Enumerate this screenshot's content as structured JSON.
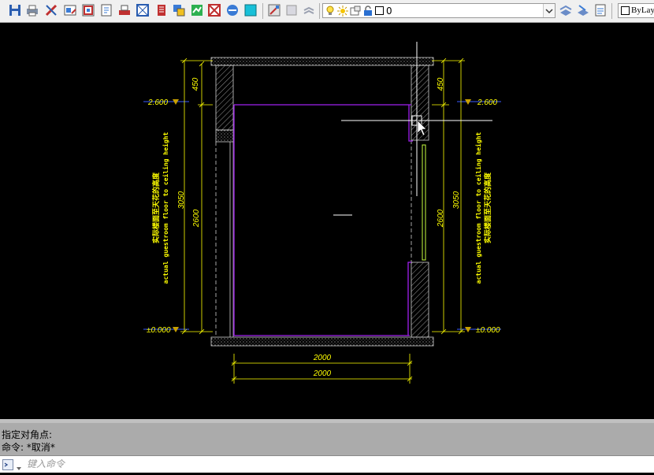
{
  "toolbar": {
    "buttons": [
      {
        "name": "save-icon"
      },
      {
        "name": "print-icon"
      },
      {
        "name": "match-properties-icon"
      },
      {
        "name": "block-editor-icon"
      },
      {
        "name": "design-center-icon"
      },
      {
        "name": "publish-icon"
      },
      {
        "name": "plot-icon"
      },
      {
        "name": "sheet-set-icon"
      },
      {
        "name": "tool-palette-icon"
      },
      {
        "name": "markup-icon"
      },
      {
        "name": "xref-icon"
      },
      {
        "name": "calculator-icon"
      },
      {
        "name": "image-icon"
      },
      {
        "name": "layer-manager-icon"
      },
      {
        "name": "layer-states-icon"
      },
      {
        "name": "layer-previous-icon"
      }
    ],
    "layer_combo_value": "0",
    "layer_flags": [
      "lightbulb-icon",
      "sun-icon",
      "lock-icon",
      "color-swatch-icon"
    ],
    "right_buttons": [
      {
        "name": "make-current-icon"
      },
      {
        "name": "layer-match-icon"
      },
      {
        "name": "layer-walk-icon"
      }
    ],
    "color_combo_value": "ByLay"
  },
  "drawing": {
    "colors": {
      "background": "#000000",
      "dimension": "#ffff00",
      "wall": "#ffffff",
      "finish": "#a020f0",
      "level_line": "#3a5cff",
      "crosshair": "#ffffff"
    },
    "level_left_top": "2.600",
    "level_left_bottom": "±0.000",
    "level_right_top": "2.600",
    "level_right_bottom": "±0.000",
    "dim_left_450": "450",
    "dim_left_3050": "3050",
    "dim_left_2600": "2600",
    "dim_right_450": "450",
    "dim_right_3050": "3050",
    "dim_right_2600": "2600",
    "dim_bottom_1": "2000",
    "dim_bottom_2": "2000",
    "note_left_cn": "实际楼面至天花的高度",
    "note_left_en": "actual guestroom floor to ceiling height",
    "note_right_cn": "实际楼面至天花的高度",
    "note_right_en": "actual guestroom floor to ceiling height"
  },
  "command": {
    "history": [
      "指定对角点:",
      "命令: *取消*"
    ],
    "placeholder": "键入命令"
  }
}
